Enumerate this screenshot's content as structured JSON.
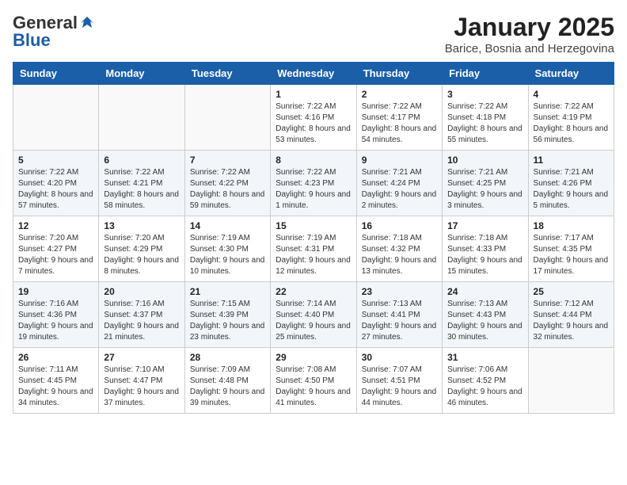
{
  "logo": {
    "general": "General",
    "blue": "Blue"
  },
  "header": {
    "month": "January 2025",
    "location": "Barice, Bosnia and Herzegovina"
  },
  "weekdays": [
    "Sunday",
    "Monday",
    "Tuesday",
    "Wednesday",
    "Thursday",
    "Friday",
    "Saturday"
  ],
  "weeks": [
    [
      {
        "day": "",
        "sunrise": "",
        "sunset": "",
        "daylight": ""
      },
      {
        "day": "",
        "sunrise": "",
        "sunset": "",
        "daylight": ""
      },
      {
        "day": "",
        "sunrise": "",
        "sunset": "",
        "daylight": ""
      },
      {
        "day": "1",
        "sunrise": "Sunrise: 7:22 AM",
        "sunset": "Sunset: 4:16 PM",
        "daylight": "Daylight: 8 hours and 53 minutes."
      },
      {
        "day": "2",
        "sunrise": "Sunrise: 7:22 AM",
        "sunset": "Sunset: 4:17 PM",
        "daylight": "Daylight: 8 hours and 54 minutes."
      },
      {
        "day": "3",
        "sunrise": "Sunrise: 7:22 AM",
        "sunset": "Sunset: 4:18 PM",
        "daylight": "Daylight: 8 hours and 55 minutes."
      },
      {
        "day": "4",
        "sunrise": "Sunrise: 7:22 AM",
        "sunset": "Sunset: 4:19 PM",
        "daylight": "Daylight: 8 hours and 56 minutes."
      }
    ],
    [
      {
        "day": "5",
        "sunrise": "Sunrise: 7:22 AM",
        "sunset": "Sunset: 4:20 PM",
        "daylight": "Daylight: 8 hours and 57 minutes."
      },
      {
        "day": "6",
        "sunrise": "Sunrise: 7:22 AM",
        "sunset": "Sunset: 4:21 PM",
        "daylight": "Daylight: 8 hours and 58 minutes."
      },
      {
        "day": "7",
        "sunrise": "Sunrise: 7:22 AM",
        "sunset": "Sunset: 4:22 PM",
        "daylight": "Daylight: 8 hours and 59 minutes."
      },
      {
        "day": "8",
        "sunrise": "Sunrise: 7:22 AM",
        "sunset": "Sunset: 4:23 PM",
        "daylight": "Daylight: 9 hours and 1 minute."
      },
      {
        "day": "9",
        "sunrise": "Sunrise: 7:21 AM",
        "sunset": "Sunset: 4:24 PM",
        "daylight": "Daylight: 9 hours and 2 minutes."
      },
      {
        "day": "10",
        "sunrise": "Sunrise: 7:21 AM",
        "sunset": "Sunset: 4:25 PM",
        "daylight": "Daylight: 9 hours and 3 minutes."
      },
      {
        "day": "11",
        "sunrise": "Sunrise: 7:21 AM",
        "sunset": "Sunset: 4:26 PM",
        "daylight": "Daylight: 9 hours and 5 minutes."
      }
    ],
    [
      {
        "day": "12",
        "sunrise": "Sunrise: 7:20 AM",
        "sunset": "Sunset: 4:27 PM",
        "daylight": "Daylight: 9 hours and 7 minutes."
      },
      {
        "day": "13",
        "sunrise": "Sunrise: 7:20 AM",
        "sunset": "Sunset: 4:29 PM",
        "daylight": "Daylight: 9 hours and 8 minutes."
      },
      {
        "day": "14",
        "sunrise": "Sunrise: 7:19 AM",
        "sunset": "Sunset: 4:30 PM",
        "daylight": "Daylight: 9 hours and 10 minutes."
      },
      {
        "day": "15",
        "sunrise": "Sunrise: 7:19 AM",
        "sunset": "Sunset: 4:31 PM",
        "daylight": "Daylight: 9 hours and 12 minutes."
      },
      {
        "day": "16",
        "sunrise": "Sunrise: 7:18 AM",
        "sunset": "Sunset: 4:32 PM",
        "daylight": "Daylight: 9 hours and 13 minutes."
      },
      {
        "day": "17",
        "sunrise": "Sunrise: 7:18 AM",
        "sunset": "Sunset: 4:33 PM",
        "daylight": "Daylight: 9 hours and 15 minutes."
      },
      {
        "day": "18",
        "sunrise": "Sunrise: 7:17 AM",
        "sunset": "Sunset: 4:35 PM",
        "daylight": "Daylight: 9 hours and 17 minutes."
      }
    ],
    [
      {
        "day": "19",
        "sunrise": "Sunrise: 7:16 AM",
        "sunset": "Sunset: 4:36 PM",
        "daylight": "Daylight: 9 hours and 19 minutes."
      },
      {
        "day": "20",
        "sunrise": "Sunrise: 7:16 AM",
        "sunset": "Sunset: 4:37 PM",
        "daylight": "Daylight: 9 hours and 21 minutes."
      },
      {
        "day": "21",
        "sunrise": "Sunrise: 7:15 AM",
        "sunset": "Sunset: 4:39 PM",
        "daylight": "Daylight: 9 hours and 23 minutes."
      },
      {
        "day": "22",
        "sunrise": "Sunrise: 7:14 AM",
        "sunset": "Sunset: 4:40 PM",
        "daylight": "Daylight: 9 hours and 25 minutes."
      },
      {
        "day": "23",
        "sunrise": "Sunrise: 7:13 AM",
        "sunset": "Sunset: 4:41 PM",
        "daylight": "Daylight: 9 hours and 27 minutes."
      },
      {
        "day": "24",
        "sunrise": "Sunrise: 7:13 AM",
        "sunset": "Sunset: 4:43 PM",
        "daylight": "Daylight: 9 hours and 30 minutes."
      },
      {
        "day": "25",
        "sunrise": "Sunrise: 7:12 AM",
        "sunset": "Sunset: 4:44 PM",
        "daylight": "Daylight: 9 hours and 32 minutes."
      }
    ],
    [
      {
        "day": "26",
        "sunrise": "Sunrise: 7:11 AM",
        "sunset": "Sunset: 4:45 PM",
        "daylight": "Daylight: 9 hours and 34 minutes."
      },
      {
        "day": "27",
        "sunrise": "Sunrise: 7:10 AM",
        "sunset": "Sunset: 4:47 PM",
        "daylight": "Daylight: 9 hours and 37 minutes."
      },
      {
        "day": "28",
        "sunrise": "Sunrise: 7:09 AM",
        "sunset": "Sunset: 4:48 PM",
        "daylight": "Daylight: 9 hours and 39 minutes."
      },
      {
        "day": "29",
        "sunrise": "Sunrise: 7:08 AM",
        "sunset": "Sunset: 4:50 PM",
        "daylight": "Daylight: 9 hours and 41 minutes."
      },
      {
        "day": "30",
        "sunrise": "Sunrise: 7:07 AM",
        "sunset": "Sunset: 4:51 PM",
        "daylight": "Daylight: 9 hours and 44 minutes."
      },
      {
        "day": "31",
        "sunrise": "Sunrise: 7:06 AM",
        "sunset": "Sunset: 4:52 PM",
        "daylight": "Daylight: 9 hours and 46 minutes."
      },
      {
        "day": "",
        "sunrise": "",
        "sunset": "",
        "daylight": ""
      }
    ]
  ]
}
